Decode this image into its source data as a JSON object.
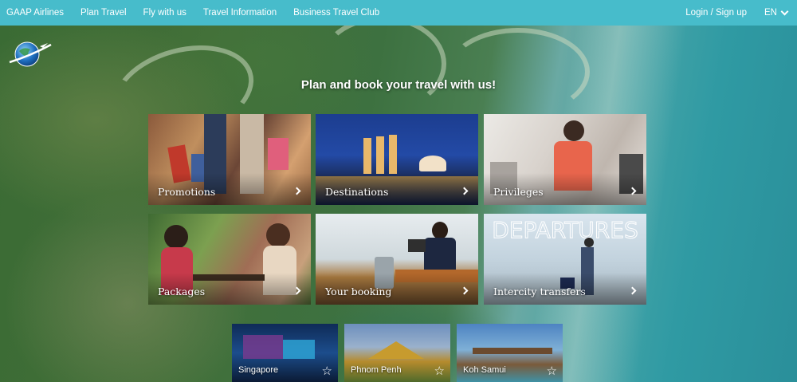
{
  "nav": {
    "brand": "GAAP Airlines",
    "items": [
      "Plan Travel",
      "Fly with us",
      "Travel Information",
      "Business Travel Club"
    ],
    "login": "Login / Sign up",
    "language": "EN"
  },
  "colors": {
    "topbar": "#47bccb",
    "text": "#ffffff"
  },
  "headline": "Plan and book your travel with us!",
  "tiles": [
    {
      "label": "Promotions",
      "icon": "chevron-right-icon"
    },
    {
      "label": "Destinations",
      "icon": "chevron-right-icon"
    },
    {
      "label": "Privileges",
      "icon": "chevron-right-icon"
    },
    {
      "label": "Packages",
      "icon": "chevron-right-icon"
    },
    {
      "label": "Your booking",
      "icon": "chevron-right-icon"
    },
    {
      "label": "Intercity transfers",
      "icon": "chevron-right-icon"
    }
  ],
  "destinations": [
    {
      "label": "Singapore",
      "icon": "star-icon"
    },
    {
      "label": "Phnom Penh",
      "icon": "star-icon"
    },
    {
      "label": "Koh Samui",
      "icon": "star-icon"
    }
  ],
  "departures_sign": "DEPARTURES"
}
